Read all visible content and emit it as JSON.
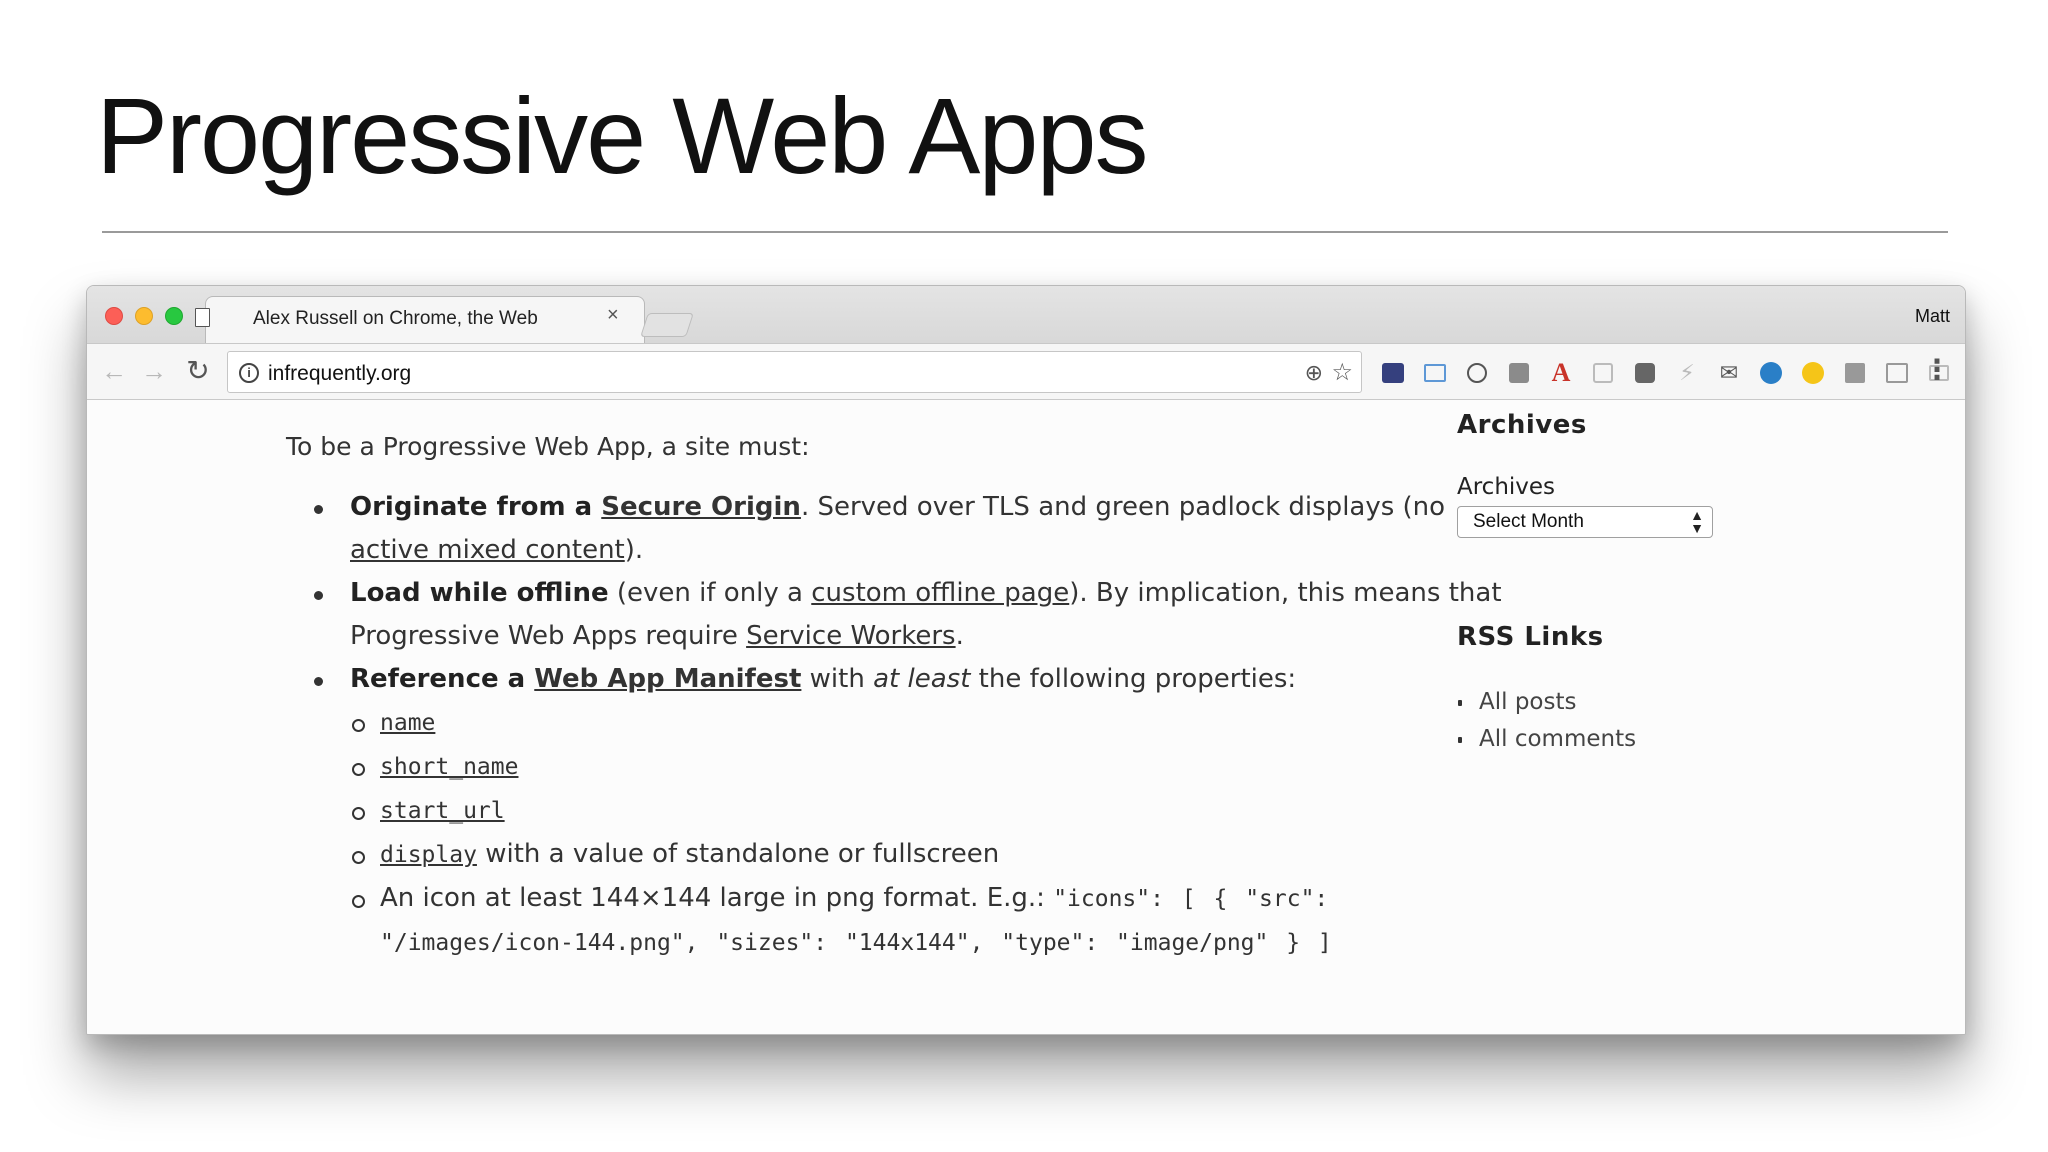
{
  "slide": {
    "title": "Progressive Web Apps"
  },
  "browser": {
    "tab": {
      "title": "Alex Russell on Chrome, the Web",
      "close": "×"
    },
    "profile_name": "Matt",
    "nav": {
      "back": "←",
      "forward": "→",
      "reload": "↻"
    },
    "omnibox": {
      "url": "infrequently.org"
    },
    "extensions": [
      "extension-1",
      "extension-2",
      "extension-3",
      "extension-4",
      "extension-5",
      "extension-6",
      "extension-7",
      "extension-8",
      "extension-9",
      "extension-10",
      "extension-11",
      "extension-12",
      "extension-13",
      "extension-14",
      "extension-15"
    ]
  },
  "content": {
    "intro": "To be a Progressive Web App, a site must:",
    "items": [
      {
        "bold": "Originate from a ",
        "link": "Secure Origin",
        "text1": ". Served over TLS and green padlock displays (no ",
        "link2": "active mixed content",
        "text2": ")."
      },
      {
        "bold": "Load while offline",
        "text1": " (even if only a ",
        "link": "custom offline page",
        "text2": "). By implication, this means that Progressive Web Apps require ",
        "link2": "Service Workers",
        "text3": "."
      },
      {
        "bold": "Reference a ",
        "link": "Web App Manifest",
        "text1": " with ",
        "italic": "at least",
        "text2": " the following properties:"
      }
    ],
    "properties": [
      {
        "code": "name"
      },
      {
        "code": "short_name"
      },
      {
        "code": "start_url"
      },
      {
        "code": "display",
        "text": " with a value of standalone or fullscreen"
      }
    ],
    "icon_item": {
      "text": "An icon at least 144×144 large in png format. E.g.: ",
      "code": "\"icons\": [ { \"src\": \"/images/icon-144.png\", \"sizes\": \"144x144\", \"type\": \"image/png\" } ]"
    }
  },
  "sidebar": {
    "archives_heading": "Archives",
    "archives_label": "Archives",
    "select_value": "Select Month",
    "rss_heading": "RSS Links",
    "rss_links": [
      "All posts",
      "All comments"
    ]
  },
  "colors": {
    "close_red": "#fc5f57",
    "minimize_yellow": "#fdbc2e",
    "maximize_green": "#28c840"
  }
}
